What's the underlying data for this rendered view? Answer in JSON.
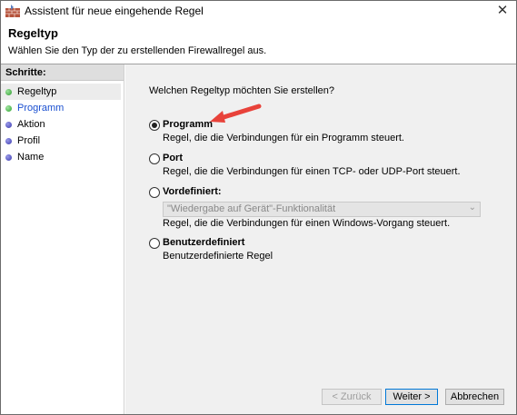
{
  "window": {
    "title": "Assistent für neue eingehende Regel",
    "close_glyph": "✕"
  },
  "header": {
    "title": "Regeltyp",
    "subtitle": "Wählen Sie den Typ der zu erstellenden Firewallregel aus."
  },
  "sidebar": {
    "title": "Schritte:",
    "steps": [
      {
        "label": "Regeltyp",
        "state": "done"
      },
      {
        "label": "Programm",
        "state": "current"
      },
      {
        "label": "Aktion",
        "state": "pending"
      },
      {
        "label": "Profil",
        "state": "pending"
      },
      {
        "label": "Name",
        "state": "pending"
      }
    ]
  },
  "main": {
    "question": "Welchen Regeltyp möchten Sie erstellen?",
    "options": [
      {
        "label": "Programm",
        "description": "Regel, die die Verbindungen für ein Programm steuert.",
        "checked": true
      },
      {
        "label": "Port",
        "description": "Regel, die die Verbindungen für einen TCP- oder UDP-Port steuert.",
        "checked": false
      },
      {
        "label": "Vordefiniert:",
        "description": "Regel, die die Verbindungen für einen Windows-Vorgang steuert.",
        "checked": false
      },
      {
        "label": "Benutzerdefiniert",
        "description": "Benutzerdefinierte Regel",
        "checked": false
      }
    ],
    "predefined_select_value": "\"Wiedergabe auf Gerät\"-Funktionalität"
  },
  "footer": {
    "back_label": "< Zurück",
    "next_label": "Weiter >",
    "cancel_label": "Abbrechen"
  },
  "colors": {
    "annotation_arrow": "#e8423a",
    "current_step_text": "#1a4fd0",
    "content_bg": "#f0f0f0"
  },
  "icons": {
    "title": "firewall-icon",
    "close": "close-icon",
    "select": "chevron-down-icon"
  }
}
